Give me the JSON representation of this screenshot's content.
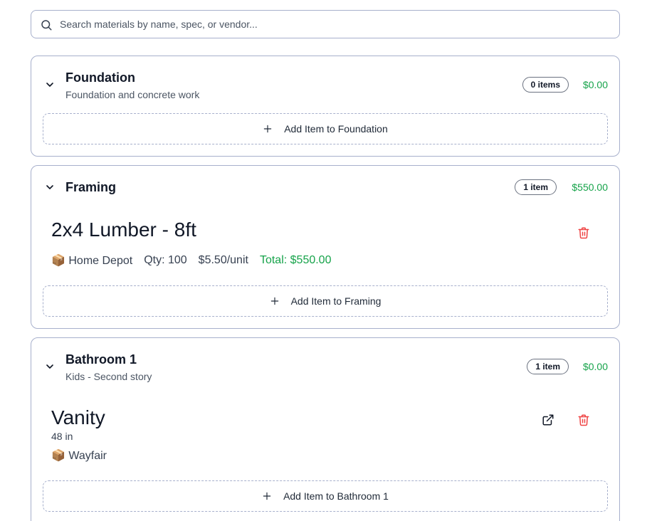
{
  "search": {
    "placeholder": "Search materials by name, spec, or vendor...",
    "value": ""
  },
  "categories": [
    {
      "title": "Foundation",
      "subtitle": "Foundation and concrete work",
      "count": "0 items",
      "total": "$0.00",
      "add_label": "Add Item to Foundation"
    },
    {
      "title": "Framing",
      "count": "1 item",
      "total": "$550.00",
      "add_label": "Add Item to Framing",
      "items": [
        {
          "name": "2x4 Lumber - 8ft",
          "vendor": "📦 Home Depot",
          "qty": "Qty: 100",
          "price": "$5.50/unit",
          "total": "Total: $550.00"
        }
      ]
    },
    {
      "title": "Bathroom 1",
      "subtitle": "Kids - Second story",
      "count": "1 item",
      "total": "$0.00",
      "add_label": "Add Item to Bathroom 1",
      "items": [
        {
          "name": "Vanity",
          "spec": "48 in",
          "vendor": "📦 Wayfair"
        }
      ]
    }
  ],
  "colors": {
    "accent_green": "#16a34a",
    "danger_red": "#ef4444",
    "border": "#a7b0cc"
  },
  "icons": [
    "search-icon",
    "chevron-down-icon",
    "plus-icon",
    "trash-icon",
    "external-link-icon"
  ]
}
